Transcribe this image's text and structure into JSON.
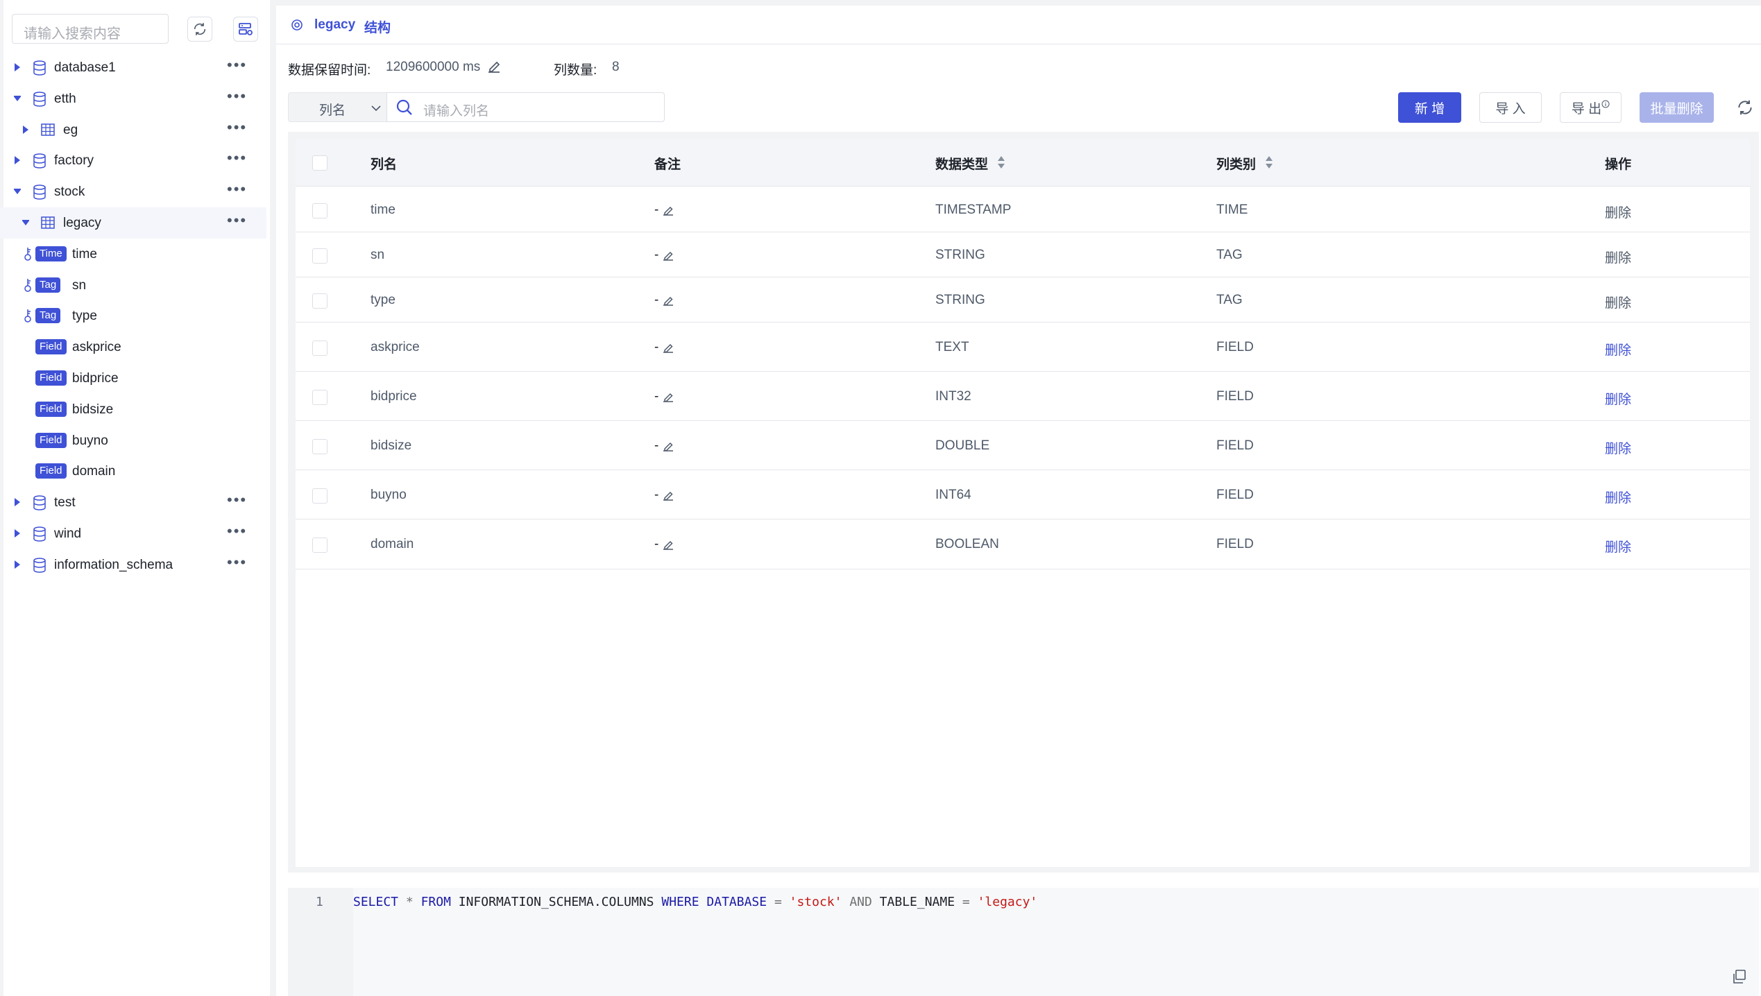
{
  "sidebar": {
    "search_placeholder": "请输入搜索内容",
    "tree": [
      {
        "label": "database1",
        "type": "db",
        "expanded": false
      },
      {
        "label": "etth",
        "type": "db",
        "expanded": true
      },
      {
        "label": "eg",
        "type": "table",
        "expanded": false
      },
      {
        "label": "factory",
        "type": "db",
        "expanded": false
      },
      {
        "label": "stock",
        "type": "db",
        "expanded": true
      },
      {
        "label": "legacy",
        "type": "table",
        "expanded": true
      },
      {
        "label": "time",
        "type": "column",
        "badge": "Time",
        "key": true
      },
      {
        "label": "sn",
        "type": "column",
        "badge": "Tag",
        "key": true
      },
      {
        "label": "type",
        "type": "column",
        "badge": "Tag",
        "key": true
      },
      {
        "label": "askprice",
        "type": "column",
        "badge": "Field",
        "key": false
      },
      {
        "label": "bidprice",
        "type": "column",
        "badge": "Field",
        "key": false
      },
      {
        "label": "bidsize",
        "type": "column",
        "badge": "Field",
        "key": false
      },
      {
        "label": "buyno",
        "type": "column",
        "badge": "Field",
        "key": false
      },
      {
        "label": "domain",
        "type": "column",
        "badge": "Field",
        "key": false
      },
      {
        "label": "test",
        "type": "db",
        "expanded": false
      },
      {
        "label": "wind",
        "type": "db",
        "expanded": false
      },
      {
        "label": "information_schema",
        "type": "db",
        "expanded": false
      }
    ]
  },
  "header": {
    "table_name": "legacy",
    "title_suffix": "结构"
  },
  "meta": {
    "retention_label": "数据保留时间:",
    "retention_value": "1209600000 ms",
    "column_count_label": "列数量:",
    "column_count_value": "8"
  },
  "filter": {
    "select_value": "列名",
    "search_placeholder": "请输入列名"
  },
  "toolbar": {
    "add_label": "新 增",
    "import_label": "导 入",
    "export_label": "导 出",
    "batch_delete_label": "批量删除"
  },
  "table": {
    "headers": {
      "name": "列名",
      "comment": "备注",
      "data_type": "数据类型",
      "category": "列类别",
      "action": "操作"
    },
    "rows": [
      {
        "name": "time",
        "comment": "-",
        "data_type": "TIMESTAMP",
        "category": "TIME",
        "action": "删除",
        "action_enabled": false
      },
      {
        "name": "sn",
        "comment": "-",
        "data_type": "STRING",
        "category": "TAG",
        "action": "删除",
        "action_enabled": false
      },
      {
        "name": "type",
        "comment": "-",
        "data_type": "STRING",
        "category": "TAG",
        "action": "删除",
        "action_enabled": false
      },
      {
        "name": "askprice",
        "comment": "-",
        "data_type": "TEXT",
        "category": "FIELD",
        "action": "删除",
        "action_enabled": true
      },
      {
        "name": "bidprice",
        "comment": "-",
        "data_type": "INT32",
        "category": "FIELD",
        "action": "删除",
        "action_enabled": true
      },
      {
        "name": "bidsize",
        "comment": "-",
        "data_type": "DOUBLE",
        "category": "FIELD",
        "action": "删除",
        "action_enabled": true
      },
      {
        "name": "buyno",
        "comment": "-",
        "data_type": "INT64",
        "category": "FIELD",
        "action": "删除",
        "action_enabled": true
      },
      {
        "name": "domain",
        "comment": "-",
        "data_type": "BOOLEAN",
        "category": "FIELD",
        "action": "删除",
        "action_enabled": true
      }
    ]
  },
  "editor": {
    "line_number": "1",
    "tokens": [
      {
        "t": "SELECT",
        "c": "kw"
      },
      {
        "t": " ",
        "c": "ident"
      },
      {
        "t": "*",
        "c": "op"
      },
      {
        "t": " ",
        "c": "ident"
      },
      {
        "t": "FROM",
        "c": "kw"
      },
      {
        "t": " INFORMATION_SCHEMA.COLUMNS ",
        "c": "ident"
      },
      {
        "t": "WHERE",
        "c": "kw"
      },
      {
        "t": " ",
        "c": "ident"
      },
      {
        "t": "DATABASE",
        "c": "kw"
      },
      {
        "t": " ",
        "c": "ident"
      },
      {
        "t": "=",
        "c": "op"
      },
      {
        "t": " ",
        "c": "ident"
      },
      {
        "t": "'stock'",
        "c": "str"
      },
      {
        "t": " ",
        "c": "ident"
      },
      {
        "t": "AND",
        "c": "op"
      },
      {
        "t": " TABLE_NAME ",
        "c": "ident"
      },
      {
        "t": "=",
        "c": "op"
      },
      {
        "t": " ",
        "c": "ident"
      },
      {
        "t": "'legacy'",
        "c": "str"
      }
    ]
  },
  "colors": {
    "accent": "#3f51d6",
    "accent_disabled": "#a9b3ea",
    "string": "#c41a16",
    "keyword": "#1a1aa6"
  }
}
